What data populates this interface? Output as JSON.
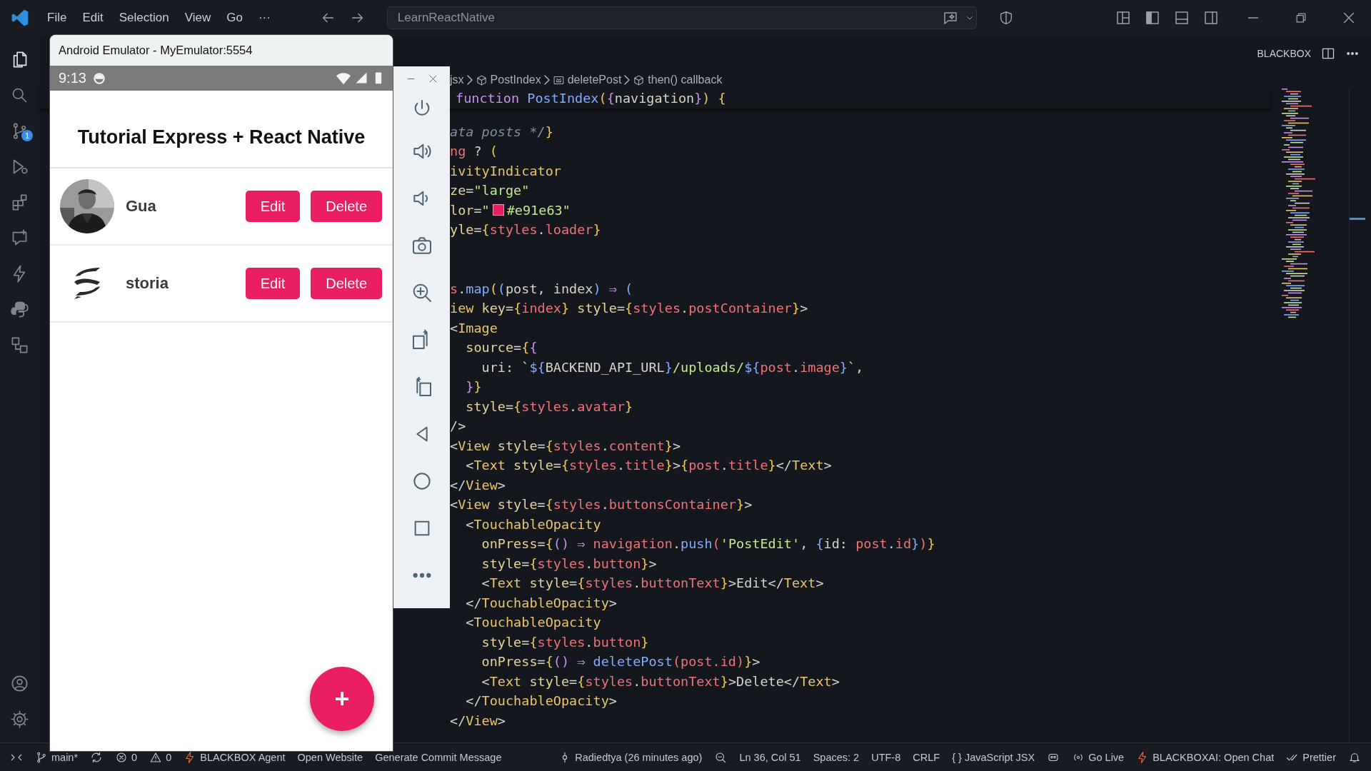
{
  "titlebar": {
    "menu": [
      "File",
      "Edit",
      "Selection",
      "View",
      "Go",
      "···"
    ],
    "search": {
      "value": "LearnReactNative"
    }
  },
  "activity_bar": {
    "items": [
      {
        "kind": "explorer",
        "selected": true
      },
      {
        "kind": "search",
        "selected": false
      },
      {
        "kind": "source-control",
        "selected": false,
        "badge": "1"
      },
      {
        "kind": "run",
        "selected": false
      },
      {
        "kind": "extensions",
        "selected": false
      },
      {
        "kind": "chat",
        "selected": false
      },
      {
        "kind": "bolt",
        "selected": false
      },
      {
        "kind": "python",
        "selected": false
      },
      {
        "kind": "remote",
        "selected": false
      }
    ]
  },
  "editor": {
    "actions_label": "BLACKBOX",
    "breadcrumbs": [
      {
        "text": "jsx"
      },
      {
        "text": "PostIndex",
        "kind": "component"
      },
      {
        "text": "deletePost",
        "kind": "variable"
      },
      {
        "text": "then() callback",
        "kind": "component"
      }
    ],
    "sticky_line": [
      {
        "kind": "kw",
        "text": "function"
      },
      {
        "kind": "fn",
        "text": " PostIndex"
      },
      {
        "kind": "brace",
        "text": "("
      },
      {
        "kind": "kw",
        "text": "{"
      },
      {
        "kind": "plain",
        "text": "navigation"
      },
      {
        "kind": "kw",
        "text": "}"
      },
      {
        "kind": "brace",
        "text": ")"
      },
      {
        "kind": "brace",
        "text": " {"
      }
    ],
    "lines": [
      {
        "kind": "code",
        "tokens": [
          {
            "kind": "comment",
            "text": "ata posts */"
          },
          {
            "kind": "brace",
            "text": "}"
          }
        ]
      },
      {
        "kind": "code",
        "tokens": [
          {
            "kind": "var",
            "text": "ng"
          },
          {
            "kind": "plain",
            "text": " ? "
          },
          {
            "kind": "brace",
            "text": "("
          }
        ]
      },
      {
        "kind": "code",
        "tokens": [
          {
            "kind": "tag",
            "text": "ivityIndicator"
          }
        ]
      },
      {
        "kind": "code",
        "tokens": [
          {
            "kind": "attr",
            "text": "ze"
          },
          {
            "kind": "plain",
            "text": "="
          },
          {
            "kind": "str",
            "text": "\"large\""
          }
        ]
      },
      {
        "kind": "code",
        "tokens": [
          {
            "kind": "attr",
            "text": "lor"
          },
          {
            "kind": "plain",
            "text": "="
          },
          {
            "kind": "str",
            "text": "\""
          },
          {
            "kind": "swatch",
            "color": "#e91e63"
          },
          {
            "kind": "str",
            "text": "#e91e63\""
          }
        ]
      },
      {
        "kind": "code",
        "tokens": [
          {
            "kind": "attr",
            "text": "yle"
          },
          {
            "kind": "plain",
            "text": "="
          },
          {
            "kind": "brace",
            "text": "{"
          },
          {
            "kind": "var",
            "text": "styles"
          },
          {
            "kind": "plain",
            "text": "."
          },
          {
            "kind": "var",
            "text": "loader"
          },
          {
            "kind": "brace",
            "text": "}"
          }
        ]
      },
      {
        "kind": "blank"
      },
      {
        "kind": "blank"
      },
      {
        "kind": "code",
        "tokens": [
          {
            "kind": "var",
            "text": "s"
          },
          {
            "kind": "plain",
            "text": "."
          },
          {
            "kind": "fn",
            "text": "map"
          },
          {
            "kind": "brace",
            "text": "("
          },
          {
            "kind": "punct",
            "text": "("
          },
          {
            "kind": "plain",
            "text": "post, index"
          },
          {
            "kind": "punct",
            "text": ")"
          },
          {
            "kind": "kw",
            "text": " ⇒ "
          },
          {
            "kind": "punct",
            "text": "("
          }
        ]
      },
      {
        "kind": "code",
        "tokens": [
          {
            "kind": "tag",
            "text": "iew"
          },
          {
            "kind": "attr",
            "text": " key"
          },
          {
            "kind": "plain",
            "text": "="
          },
          {
            "kind": "brace",
            "text": "{"
          },
          {
            "kind": "var",
            "text": "index"
          },
          {
            "kind": "brace",
            "text": "}"
          },
          {
            "kind": "attr",
            "text": " style"
          },
          {
            "kind": "plain",
            "text": "="
          },
          {
            "kind": "brace",
            "text": "{"
          },
          {
            "kind": "var",
            "text": "styles"
          },
          {
            "kind": "plain",
            "text": "."
          },
          {
            "kind": "var",
            "text": "postContainer"
          },
          {
            "kind": "brace",
            "text": "}"
          },
          {
            "kind": "plain",
            "text": ">"
          }
        ]
      },
      {
        "kind": "code",
        "tokens": [
          {
            "kind": "plain",
            "text": "<"
          },
          {
            "kind": "tag",
            "text": "Image"
          }
        ]
      },
      {
        "kind": "code",
        "tokens": [
          {
            "kind": "attr",
            "text": "  source"
          },
          {
            "kind": "plain",
            "text": "="
          },
          {
            "kind": "brace",
            "text": "{"
          },
          {
            "kind": "kw",
            "text": "{"
          }
        ]
      },
      {
        "kind": "code",
        "tokens": [
          {
            "kind": "plain",
            "text": "    uri: "
          },
          {
            "kind": "str",
            "text": "`"
          },
          {
            "kind": "punct",
            "text": "${"
          },
          {
            "kind": "plain",
            "text": "BACKEND_API_URL"
          },
          {
            "kind": "punct",
            "text": "}"
          },
          {
            "kind": "str",
            "text": "/uploads/"
          },
          {
            "kind": "punct",
            "text": "${"
          },
          {
            "kind": "var",
            "text": "post"
          },
          {
            "kind": "plain",
            "text": "."
          },
          {
            "kind": "var",
            "text": "image"
          },
          {
            "kind": "punct",
            "text": "}"
          },
          {
            "kind": "str",
            "text": "`"
          },
          {
            "kind": "plain",
            "text": ","
          }
        ]
      },
      {
        "kind": "code",
        "tokens": [
          {
            "kind": "kw",
            "text": "  }"
          },
          {
            "kind": "brace",
            "text": "}"
          }
        ]
      },
      {
        "kind": "code",
        "tokens": [
          {
            "kind": "attr",
            "text": "  style"
          },
          {
            "kind": "plain",
            "text": "="
          },
          {
            "kind": "brace",
            "text": "{"
          },
          {
            "kind": "var",
            "text": "styles"
          },
          {
            "kind": "plain",
            "text": "."
          },
          {
            "kind": "var",
            "text": "avatar"
          },
          {
            "kind": "brace",
            "text": "}"
          }
        ]
      },
      {
        "kind": "code",
        "tokens": [
          {
            "kind": "plain",
            "text": "/>"
          }
        ]
      },
      {
        "kind": "code",
        "tokens": [
          {
            "kind": "plain",
            "text": "<"
          },
          {
            "kind": "tag",
            "text": "View"
          },
          {
            "kind": "attr",
            "text": " style"
          },
          {
            "kind": "plain",
            "text": "="
          },
          {
            "kind": "brace",
            "text": "{"
          },
          {
            "kind": "var",
            "text": "styles"
          },
          {
            "kind": "plain",
            "text": "."
          },
          {
            "kind": "var",
            "text": "content"
          },
          {
            "kind": "brace",
            "text": "}"
          },
          {
            "kind": "plain",
            "text": ">"
          }
        ]
      },
      {
        "kind": "code",
        "tokens": [
          {
            "kind": "plain",
            "text": "  <"
          },
          {
            "kind": "tag",
            "text": "Text"
          },
          {
            "kind": "attr",
            "text": " style"
          },
          {
            "kind": "plain",
            "text": "="
          },
          {
            "kind": "brace",
            "text": "{"
          },
          {
            "kind": "var",
            "text": "styles"
          },
          {
            "kind": "plain",
            "text": "."
          },
          {
            "kind": "var",
            "text": "title"
          },
          {
            "kind": "brace",
            "text": "}"
          },
          {
            "kind": "plain",
            "text": ">"
          },
          {
            "kind": "brace",
            "text": "{"
          },
          {
            "kind": "var",
            "text": "post"
          },
          {
            "kind": "plain",
            "text": "."
          },
          {
            "kind": "var",
            "text": "title"
          },
          {
            "kind": "brace",
            "text": "}"
          },
          {
            "kind": "plain",
            "text": "</"
          },
          {
            "kind": "tag",
            "text": "Text"
          },
          {
            "kind": "plain",
            "text": ">"
          }
        ]
      },
      {
        "kind": "code",
        "tokens": [
          {
            "kind": "plain",
            "text": "</"
          },
          {
            "kind": "tag",
            "text": "View"
          },
          {
            "kind": "plain",
            "text": ">"
          }
        ]
      },
      {
        "kind": "code",
        "tokens": [
          {
            "kind": "plain",
            "text": "<"
          },
          {
            "kind": "tag",
            "text": "View"
          },
          {
            "kind": "attr",
            "text": " style"
          },
          {
            "kind": "plain",
            "text": "="
          },
          {
            "kind": "brace",
            "text": "{"
          },
          {
            "kind": "var",
            "text": "styles"
          },
          {
            "kind": "plain",
            "text": "."
          },
          {
            "kind": "var",
            "text": "buttonsContainer"
          },
          {
            "kind": "brace",
            "text": "}"
          },
          {
            "kind": "plain",
            "text": ">"
          }
        ]
      },
      {
        "kind": "code",
        "tokens": [
          {
            "kind": "plain",
            "text": "  <"
          },
          {
            "kind": "tag",
            "text": "TouchableOpacity"
          }
        ]
      },
      {
        "kind": "code",
        "tokens": [
          {
            "kind": "attr",
            "text": "    onPress"
          },
          {
            "kind": "plain",
            "text": "="
          },
          {
            "kind": "brace",
            "text": "{"
          },
          {
            "kind": "kw",
            "text": "()"
          },
          {
            "kind": "kw",
            "text": " ⇒ "
          },
          {
            "kind": "var",
            "text": "navigation"
          },
          {
            "kind": "plain",
            "text": "."
          },
          {
            "kind": "fn",
            "text": "push"
          },
          {
            "kind": "var",
            "text": "("
          },
          {
            "kind": "str",
            "text": "'PostEdit'"
          },
          {
            "kind": "plain",
            "text": ", "
          },
          {
            "kind": "punct",
            "text": "{"
          },
          {
            "kind": "plain",
            "text": "id: "
          },
          {
            "kind": "var",
            "text": "post"
          },
          {
            "kind": "plain",
            "text": "."
          },
          {
            "kind": "var",
            "text": "id"
          },
          {
            "kind": "punct",
            "text": "}"
          },
          {
            "kind": "var",
            "text": ")"
          },
          {
            "kind": "brace",
            "text": "}"
          }
        ]
      },
      {
        "kind": "code",
        "tokens": [
          {
            "kind": "attr",
            "text": "    style"
          },
          {
            "kind": "plain",
            "text": "="
          },
          {
            "kind": "brace",
            "text": "{"
          },
          {
            "kind": "var",
            "text": "styles"
          },
          {
            "kind": "plain",
            "text": "."
          },
          {
            "kind": "var",
            "text": "button"
          },
          {
            "kind": "brace",
            "text": "}"
          },
          {
            "kind": "plain",
            "text": ">"
          }
        ]
      },
      {
        "kind": "code",
        "tokens": [
          {
            "kind": "plain",
            "text": "    <"
          },
          {
            "kind": "tag",
            "text": "Text"
          },
          {
            "kind": "attr",
            "text": " style"
          },
          {
            "kind": "plain",
            "text": "="
          },
          {
            "kind": "brace",
            "text": "{"
          },
          {
            "kind": "var",
            "text": "styles"
          },
          {
            "kind": "plain",
            "text": "."
          },
          {
            "kind": "var",
            "text": "buttonText"
          },
          {
            "kind": "brace",
            "text": "}"
          },
          {
            "kind": "plain",
            "text": ">Edit</"
          },
          {
            "kind": "tag",
            "text": "Text"
          },
          {
            "kind": "plain",
            "text": ">"
          }
        ]
      },
      {
        "kind": "code",
        "tokens": [
          {
            "kind": "plain",
            "text": "  </"
          },
          {
            "kind": "tag",
            "text": "TouchableOpacity"
          },
          {
            "kind": "plain",
            "text": ">"
          }
        ]
      },
      {
        "kind": "code",
        "tokens": [
          {
            "kind": "plain",
            "text": "  <"
          },
          {
            "kind": "tag",
            "text": "TouchableOpacity"
          }
        ]
      },
      {
        "kind": "code",
        "tokens": [
          {
            "kind": "attr",
            "text": "    style"
          },
          {
            "kind": "plain",
            "text": "="
          },
          {
            "kind": "brace",
            "text": "{"
          },
          {
            "kind": "var",
            "text": "styles"
          },
          {
            "kind": "plain",
            "text": "."
          },
          {
            "kind": "var",
            "text": "button"
          },
          {
            "kind": "brace",
            "text": "}"
          }
        ]
      },
      {
        "kind": "code",
        "tokens": [
          {
            "kind": "attr",
            "text": "    onPress"
          },
          {
            "kind": "plain",
            "text": "="
          },
          {
            "kind": "brace",
            "text": "{"
          },
          {
            "kind": "kw",
            "text": "()"
          },
          {
            "kind": "kw",
            "text": " ⇒ "
          },
          {
            "kind": "fn",
            "text": "deletePost"
          },
          {
            "kind": "var",
            "text": "(post.id)"
          },
          {
            "kind": "brace",
            "text": "}"
          },
          {
            "kind": "plain",
            "text": ">"
          }
        ]
      },
      {
        "kind": "code",
        "tokens": [
          {
            "kind": "plain",
            "text": "    <"
          },
          {
            "kind": "tag",
            "text": "Text"
          },
          {
            "kind": "attr",
            "text": " style"
          },
          {
            "kind": "plain",
            "text": "="
          },
          {
            "kind": "brace",
            "text": "{"
          },
          {
            "kind": "var",
            "text": "styles"
          },
          {
            "kind": "plain",
            "text": "."
          },
          {
            "kind": "var",
            "text": "buttonText"
          },
          {
            "kind": "brace",
            "text": "}"
          },
          {
            "kind": "plain",
            "text": ">Delete</"
          },
          {
            "kind": "tag",
            "text": "Text"
          },
          {
            "kind": "plain",
            "text": ">"
          }
        ]
      },
      {
        "kind": "code",
        "tokens": [
          {
            "kind": "plain",
            "text": "  </"
          },
          {
            "kind": "tag",
            "text": "TouchableOpacity"
          },
          {
            "kind": "plain",
            "text": ">"
          }
        ]
      },
      {
        "kind": "code",
        "tokens": [
          {
            "kind": "plain",
            "text": "</"
          },
          {
            "kind": "tag",
            "text": "View"
          },
          {
            "kind": "plain",
            "text": ">"
          }
        ]
      }
    ]
  },
  "emulator": {
    "title": "Android Emulator - MyEmulator:5554",
    "time": "9:13",
    "app_title": "Tutorial Express + React Native",
    "posts": [
      {
        "title": "Gua",
        "buttons": [
          "Edit",
          "Delete"
        ]
      },
      {
        "title": "storia",
        "kind": "logo",
        "buttons": [
          "Edit",
          "Delete"
        ]
      }
    ],
    "fab": "+"
  },
  "status_bar": {
    "left": [
      {
        "kind": "remote"
      },
      {
        "kind": "branch",
        "text": "main*"
      },
      {
        "kind": "sync"
      },
      {
        "kind": "errors",
        "text": "0"
      },
      {
        "kind": "warnings",
        "text": "0"
      },
      {
        "kind": "bolt",
        "text": "BLACKBOX Agent"
      },
      {
        "kind": "plain",
        "text": "Open Website"
      },
      {
        "kind": "plain",
        "text": "Generate Commit Message"
      }
    ],
    "right": [
      {
        "kind": "commit",
        "text": "Radiedtya (26 minutes ago)"
      },
      {
        "kind": "zoom"
      },
      {
        "kind": "plain",
        "text": "Ln 36, Col 51"
      },
      {
        "kind": "plain",
        "text": "Spaces: 2"
      },
      {
        "kind": "plain",
        "text": "UTF-8"
      },
      {
        "kind": "plain",
        "text": "CRLF"
      },
      {
        "kind": "plain",
        "text": "{ } JavaScript JSX"
      },
      {
        "kind": "copilot"
      },
      {
        "kind": "broadcast",
        "text": "Go Live"
      },
      {
        "kind": "bolt",
        "text": "BLACKBOXAI: Open Chat"
      },
      {
        "kind": "check",
        "text": "Prettier"
      },
      {
        "kind": "bell"
      }
    ]
  }
}
